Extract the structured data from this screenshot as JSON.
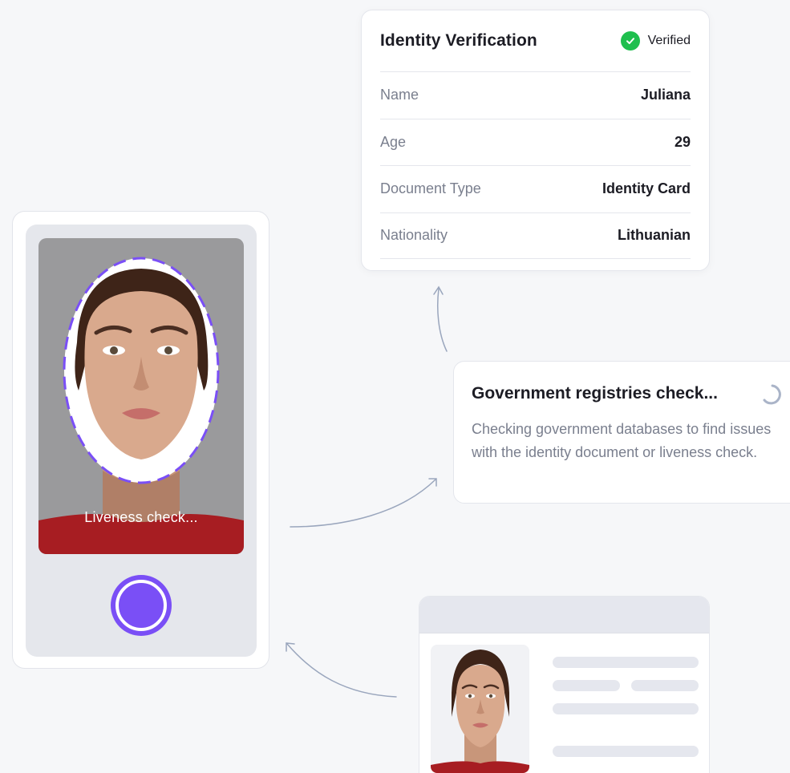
{
  "identity_card": {
    "title": "Identity Verification",
    "status": "Verified",
    "rows": [
      {
        "label": "Name",
        "value": "Juliana"
      },
      {
        "label": "Age",
        "value": "29"
      },
      {
        "label": "Document Type",
        "value": "Identity Card"
      },
      {
        "label": "Nationality",
        "value": "Lithuanian"
      }
    ]
  },
  "registries_card": {
    "title": "Government registries check...",
    "description": "Checking government databases to find issues with the identity document or liveness check."
  },
  "phone": {
    "status_text": "Liveness check..."
  },
  "colors": {
    "accent": "#7a4ff6",
    "verified": "#1fbf4e",
    "arrow": "#9aa6bd"
  },
  "icons": [
    "check-circle-icon",
    "loading-spinner-icon",
    "arrow-icon"
  ]
}
